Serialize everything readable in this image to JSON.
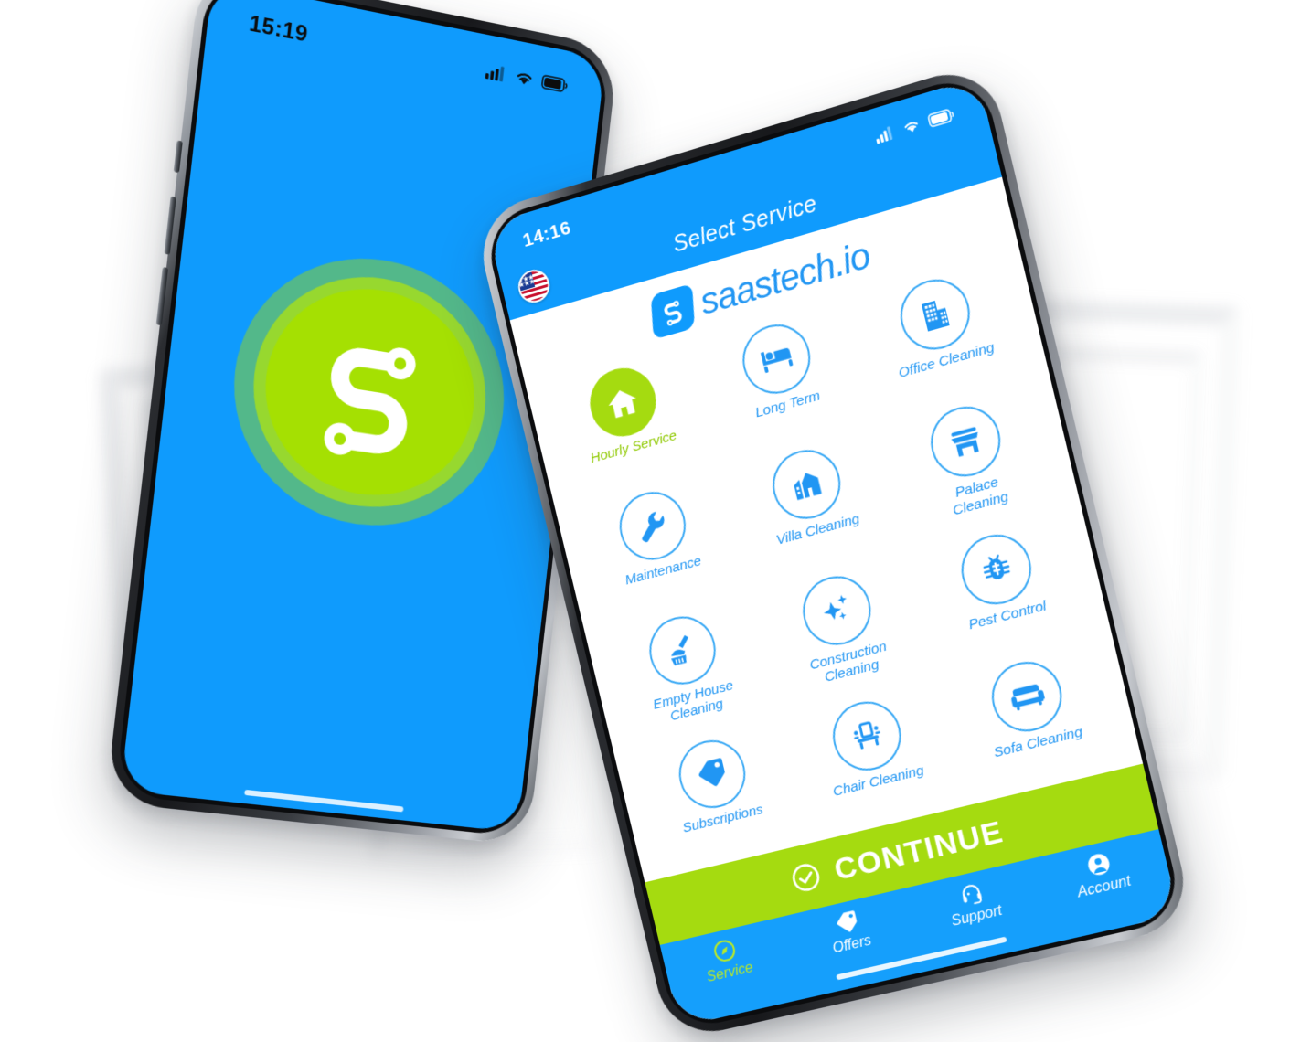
{
  "brand": {
    "name": "saastech.io",
    "logo_icon": "saastech-s-node-logo",
    "colors": {
      "blue": "#0f9bfd",
      "blue_accent": "#2196f3",
      "green": "#a5db10",
      "green_splash": "#a5e002",
      "white": "#ffffff"
    }
  },
  "left_phone": {
    "status_bar": {
      "time": "15:19",
      "signal_icon": "cellular-signal-icon",
      "wifi_icon": "wifi-icon",
      "battery_icon": "battery-icon"
    },
    "splash": {
      "logo_icon": "saastech-s-node-logo",
      "background_color": "#0f9bfd",
      "badge_color": "#a5e002"
    }
  },
  "right_phone": {
    "status_bar": {
      "time": "14:16",
      "signal_icon": "cellular-signal-icon",
      "wifi_icon": "wifi-icon",
      "battery_icon": "battery-icon"
    },
    "header": {
      "title": "Select Service",
      "language_flag": "us-flag-icon"
    },
    "brand_row": {
      "wordmark": "saastech.io",
      "tile_icon": "saastech-s-node-logo"
    },
    "services": [
      {
        "label": "Hourly Service",
        "icon": "house-icon",
        "selected": true
      },
      {
        "label": "Long Term",
        "icon": "bed-icon",
        "selected": false
      },
      {
        "label": "Office Cleaning",
        "icon": "office-building-icon",
        "selected": false
      },
      {
        "label": "Maintenance",
        "icon": "wrench-icon",
        "selected": false
      },
      {
        "label": "Villa Cleaning",
        "icon": "villa-icon",
        "selected": false
      },
      {
        "label": "Palace Cleaning",
        "icon": "palace-icon",
        "selected": false
      },
      {
        "label": "Empty House Cleaning",
        "icon": "broom-icon",
        "selected": false
      },
      {
        "label": "Construction Cleaning",
        "icon": "sparkles-icon",
        "selected": false
      },
      {
        "label": "Pest Control",
        "icon": "bug-icon",
        "selected": false
      },
      {
        "label": "Subscriptions",
        "icon": "tag-icon",
        "selected": false
      },
      {
        "label": "Chair Cleaning",
        "icon": "chair-icon",
        "selected": false
      },
      {
        "label": "Sofa Cleaning",
        "icon": "sofa-icon",
        "selected": false
      }
    ],
    "continue_button": {
      "label": "CONTINUE",
      "icon": "check-circle-icon",
      "background": "#a5db10"
    },
    "tab_bar": [
      {
        "label": "Service",
        "icon": "compass-icon",
        "active": true
      },
      {
        "label": "Offers",
        "icon": "tag-icon",
        "active": false
      },
      {
        "label": "Support",
        "icon": "headset-icon",
        "active": false
      },
      {
        "label": "Account",
        "icon": "person-icon",
        "active": false
      }
    ]
  }
}
